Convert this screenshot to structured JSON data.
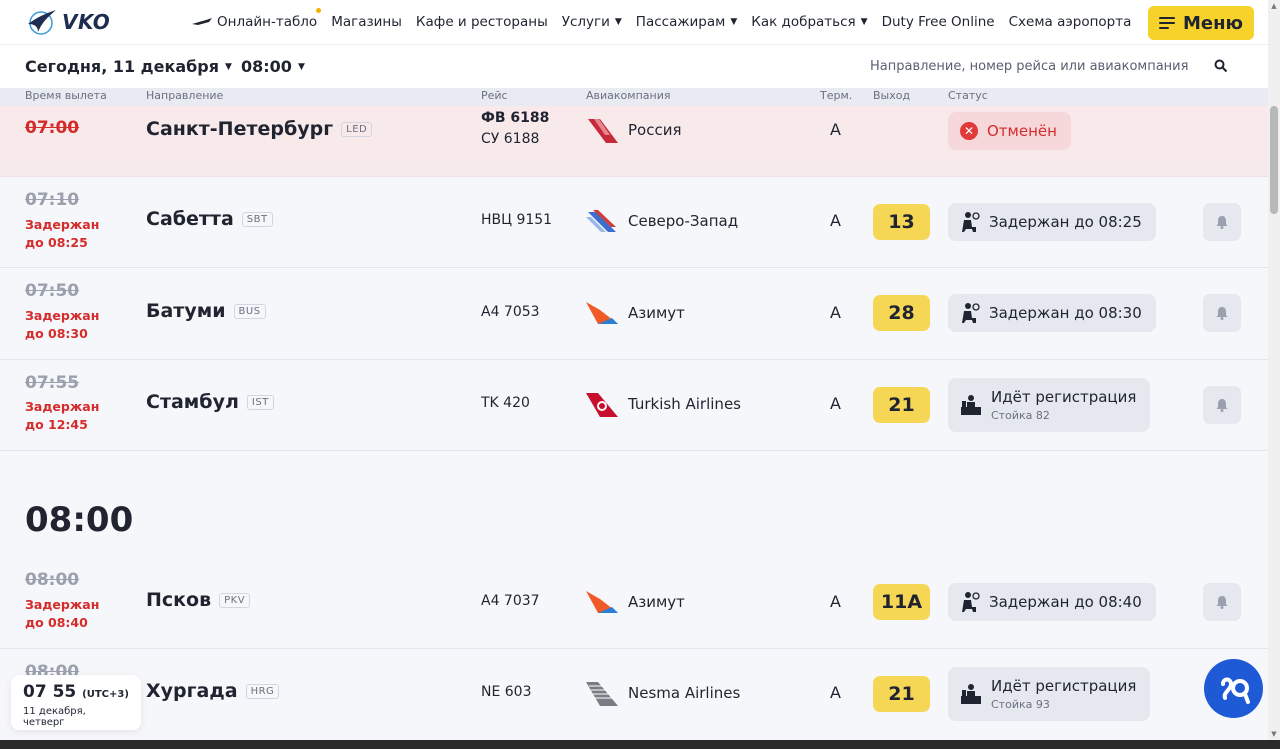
{
  "header": {
    "logo_text": "VKO",
    "nav": [
      {
        "label": "Онлайн-табло",
        "has_dropdown": false
      },
      {
        "label": "Магазины",
        "has_dropdown": false
      },
      {
        "label": "Кафе и рестораны",
        "has_dropdown": false
      },
      {
        "label": "Услуги",
        "has_dropdown": true
      },
      {
        "label": "Пассажирам",
        "has_dropdown": true
      },
      {
        "label": "Как добраться",
        "has_dropdown": true
      },
      {
        "label": "Duty Free Online",
        "has_dropdown": false
      },
      {
        "label": "Схема аэропорта",
        "has_dropdown": false
      }
    ],
    "menu_label": "Меню",
    "accent_color": "#f6d22a"
  },
  "filters": {
    "date_label": "Сегодня, 11 декабря",
    "time_label": "08:00",
    "search_placeholder": "Направление, номер рейса или авиакомпания"
  },
  "columns": {
    "time": "Время вылета",
    "destination": "Направление",
    "flight": "Рейс",
    "airline": "Авиакомпания",
    "terminal": "Терм.",
    "gate": "Выход",
    "status": "Статус"
  },
  "rows": [
    {
      "time": "07:00",
      "delay1": "",
      "delay2": "",
      "destination": "Санкт-Петербург",
      "code": "LED",
      "flight1": "ФВ 6188",
      "flight2": "СУ 6188",
      "airline": "Россия",
      "terminal": "A",
      "gate": "",
      "status": "Отменён",
      "status_sub": ""
    },
    {
      "time": "07:10",
      "delay1": "Задержан",
      "delay2": "до 08:25",
      "destination": "Сабетта",
      "code": "SBT",
      "flight1": "НВЦ 9151",
      "flight2": "",
      "airline": "Северо-Запад",
      "terminal": "A",
      "gate": "13",
      "status": "Задержан до 08:25",
      "status_sub": ""
    },
    {
      "time": "07:50",
      "delay1": "Задержан",
      "delay2": "до 08:30",
      "destination": "Батуми",
      "code": "BUS",
      "flight1": "А4 7053",
      "flight2": "",
      "airline": "Азимут",
      "terminal": "A",
      "gate": "28",
      "status": "Задержан до 08:30",
      "status_sub": ""
    },
    {
      "time": "07:55",
      "delay1": "Задержан",
      "delay2": "до 12:45",
      "destination": "Стамбул",
      "code": "IST",
      "flight1": "TK 420",
      "flight2": "",
      "airline": "Turkish Airlines",
      "terminal": "A",
      "gate": "21",
      "status": "Идёт регистрация",
      "status_sub": "Стойка 82"
    },
    {
      "time": "08:00",
      "delay1": "Задержан",
      "delay2": "до 08:40",
      "destination": "Псков",
      "code": "PKV",
      "flight1": "А4 7037",
      "flight2": "",
      "airline": "Азимут",
      "terminal": "A",
      "gate": "11A",
      "status": "Задержан до 08:40",
      "status_sub": ""
    },
    {
      "time": "08:00",
      "delay1": "",
      "delay2": "",
      "destination": "Хургада",
      "code": "HRG",
      "flight1": "NE 603",
      "flight2": "",
      "airline": "Nesma Airlines",
      "terminal": "A",
      "gate": "21",
      "status": "Идёт регистрация",
      "status_sub": "Стойка 93"
    }
  ],
  "hour_heading": "08:00",
  "clock": {
    "time": "07 55",
    "tz": "(UTC+3)",
    "date": "11 декабря, четверг"
  }
}
